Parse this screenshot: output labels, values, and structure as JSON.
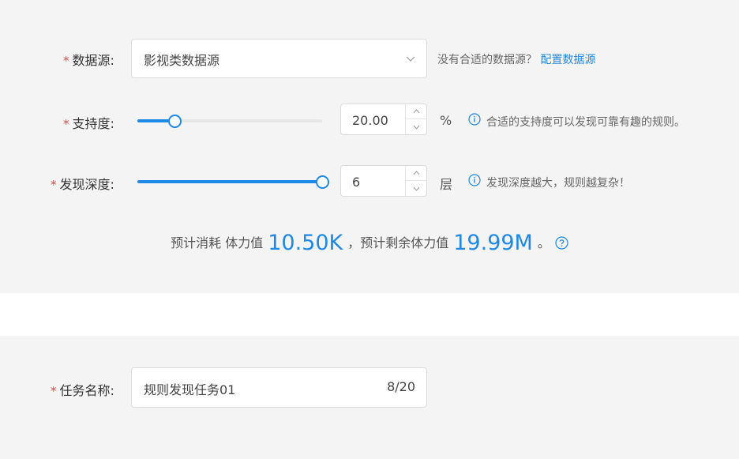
{
  "datasource": {
    "label": "数据源:",
    "value": "影视类数据源",
    "hint": "没有合适的数据源？",
    "link": "配置数据源"
  },
  "support": {
    "label": "支持度:",
    "value": "20.00",
    "unit": "%",
    "hint": "合适的支持度可以发现可靠有趣的规则。",
    "slider_fraction": 0.2
  },
  "depth": {
    "label": "发现深度:",
    "value": "6",
    "unit": "层",
    "hint": "发现深度越大，规则越复杂！",
    "slider_fraction": 1.0
  },
  "cost": {
    "prefix": "预计消耗 体力值",
    "consume": "10.50K",
    "middle": "，预计剩余体力值",
    "remain": "19.99M",
    "suffix": "。"
  },
  "task": {
    "label": "任务名称:",
    "value": "规则发现任务01",
    "counter": "8/20"
  },
  "required_mark": "*",
  "colors": {
    "accent": "#1e88e5",
    "required": "#e64545"
  },
  "icons": [
    "chevron-down-icon",
    "info-icon",
    "chevron-up-icon",
    "question-icon"
  ]
}
